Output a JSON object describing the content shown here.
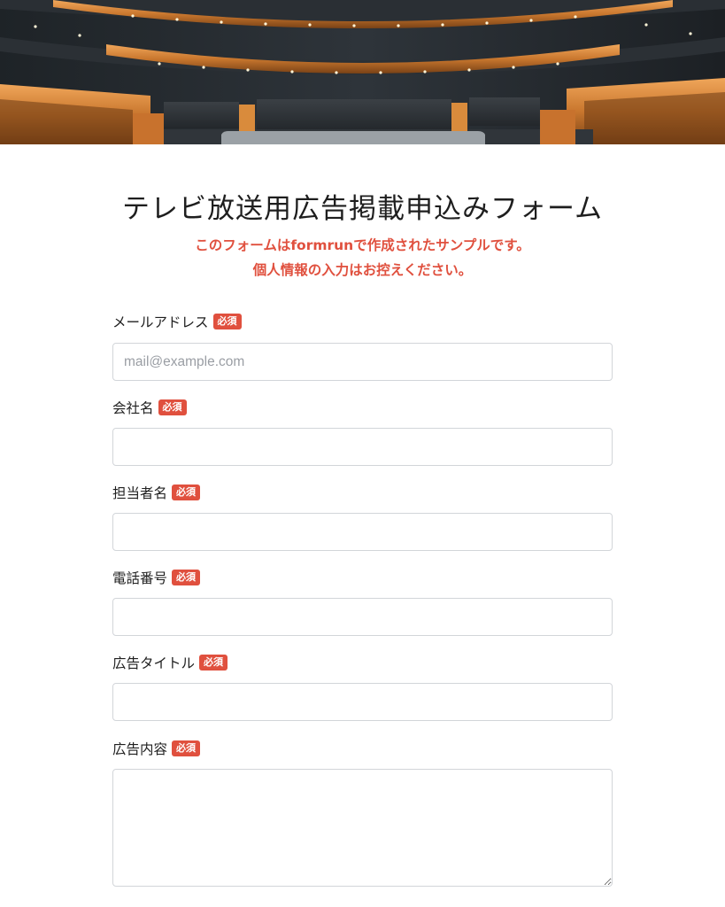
{
  "form": {
    "title": "テレビ放送用広告掲載申込みフォーム",
    "notice_line1": "このフォームはformrunで作成されたサンプルです。",
    "notice_line2": "個人情報の入力はお控えください。",
    "required_badge": "必須"
  },
  "fields": {
    "email": {
      "label": "メールアドレス",
      "placeholder": "mail@example.com",
      "value": ""
    },
    "company": {
      "label": "会社名",
      "value": ""
    },
    "contact_person": {
      "label": "担当者名",
      "value": ""
    },
    "phone": {
      "label": "電話番号",
      "value": ""
    },
    "ad_title": {
      "label": "広告タイトル",
      "value": ""
    },
    "ad_content": {
      "label": "広告内容",
      "value": ""
    }
  },
  "colors": {
    "accent": "#e0503e",
    "border": "#d2d5d9",
    "text": "#222222"
  },
  "icons": {
    "hero": "concert-hall-image"
  }
}
